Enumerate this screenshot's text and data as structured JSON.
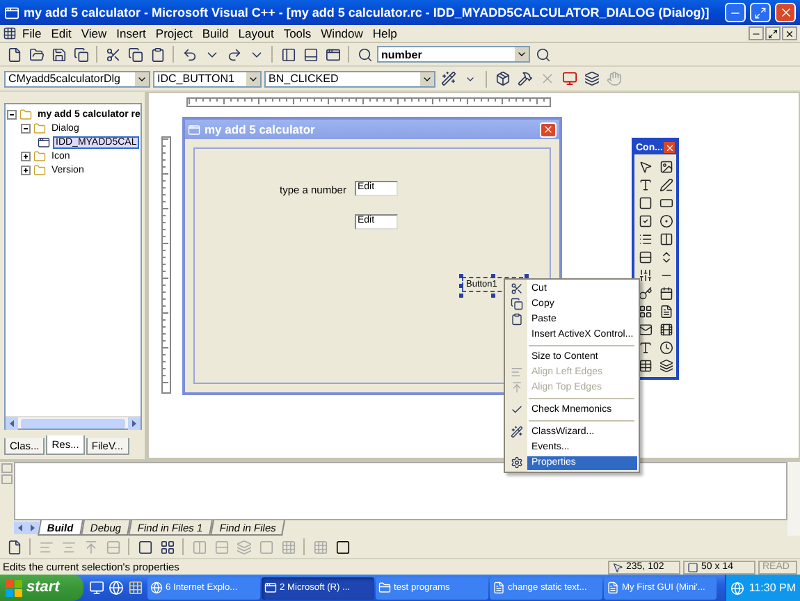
{
  "window": {
    "title": "my add 5 calculator - Microsoft Visual C++ - [my add 5 calculator.rc - IDD_MYADD5CALCULATOR_DIALOG (Dialog)]"
  },
  "menu": [
    "File",
    "Edit",
    "View",
    "Insert",
    "Project",
    "Build",
    "Layout",
    "Tools",
    "Window",
    "Help"
  ],
  "find_combo": {
    "value": "number"
  },
  "wizard_bar": [
    {
      "value": "CMyadd5calculatorDlg"
    },
    {
      "value": "IDC_BUTTON1"
    },
    {
      "value": "BN_CLICKED"
    }
  ],
  "workspace": {
    "tree": [
      {
        "label": "my add 5 calculator re",
        "expanded": true,
        "selected": false,
        "children": [
          {
            "label": "Dialog",
            "expanded": true,
            "selected": false,
            "children": [
              {
                "label": "IDD_MYADD5CAL",
                "selected": true
              }
            ]
          },
          {
            "label": "Icon",
            "expanded": false,
            "selected": false
          },
          {
            "label": "Version",
            "expanded": false,
            "selected": false
          }
        ]
      }
    ],
    "tabs": [
      {
        "label": "Clas...",
        "selected": false
      },
      {
        "label": "Res...",
        "selected": true
      },
      {
        "label": "FileV...",
        "selected": false
      }
    ]
  },
  "dialog": {
    "title": "my add 5 calculator",
    "label": "type a number",
    "edits": [
      "Edit",
      "Edit"
    ],
    "button": {
      "label": "Button1",
      "selected": true
    }
  },
  "controls_palette": {
    "title": "Con..."
  },
  "context_menu": [
    {
      "kind": "item",
      "label": "Cut",
      "disabled": false,
      "selected": false
    },
    {
      "kind": "item",
      "label": "Copy",
      "disabled": false,
      "selected": false
    },
    {
      "kind": "item",
      "label": "Paste",
      "disabled": false,
      "selected": false
    },
    {
      "kind": "item",
      "label": "Insert ActiveX Control...",
      "disabled": false,
      "selected": false
    },
    {
      "kind": "separator"
    },
    {
      "kind": "item",
      "label": "Size to Content",
      "disabled": false,
      "selected": false
    },
    {
      "kind": "item",
      "label": "Align Left Edges",
      "disabled": true,
      "selected": false
    },
    {
      "kind": "item",
      "label": "Align Top Edges",
      "disabled": true,
      "selected": false
    },
    {
      "kind": "separator"
    },
    {
      "kind": "item",
      "label": "Check Mnemonics",
      "disabled": false,
      "selected": false
    },
    {
      "kind": "separator"
    },
    {
      "kind": "item",
      "label": "ClassWizard...",
      "disabled": false,
      "selected": false
    },
    {
      "kind": "item",
      "label": "Events...",
      "disabled": false,
      "selected": false
    },
    {
      "kind": "item",
      "label": "Properties",
      "disabled": false,
      "selected": true
    }
  ],
  "output": {
    "tabs": [
      {
        "label": "Build",
        "selected": true
      },
      {
        "label": "Debug",
        "selected": false
      },
      {
        "label": "Find in Files 1",
        "selected": false
      },
      {
        "label": "Find in Files",
        "selected": false
      }
    ]
  },
  "status_bar": {
    "message": "Edits the current selection's properties",
    "position": "235, 102",
    "size": "50 x 14",
    "mode": {
      "label": "READ",
      "disabled": true
    }
  },
  "taskbar": {
    "start": "start",
    "tasks": [
      {
        "label": "6 Internet Explo...",
        "selected": false
      },
      {
        "label": "2 Microsoft (R) ...",
        "selected": true
      },
      {
        "label": "test programs",
        "selected": false
      },
      {
        "label": "change static text...",
        "selected": false
      },
      {
        "label": "My First GUI (Mini'...",
        "selected": false
      }
    ],
    "clock": "11:30 PM"
  }
}
